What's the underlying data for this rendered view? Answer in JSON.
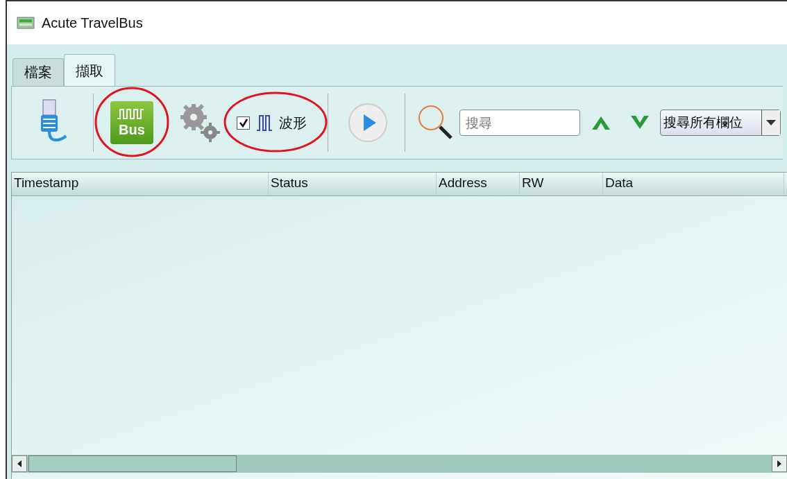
{
  "window": {
    "title": "Acute TravelBus"
  },
  "tabs": [
    {
      "label": "檔案",
      "selected": false
    },
    {
      "label": "擷取",
      "selected": true
    }
  ],
  "toolbar": {
    "bus_button": {
      "label": "Bus"
    },
    "waveform": {
      "label": "波形",
      "checked": true
    },
    "search": {
      "placeholder": "搜尋"
    },
    "search_scope": {
      "value": "搜尋所有欄位"
    }
  },
  "table": {
    "columns": [
      "Timestamp",
      "Status",
      "Address",
      "RW",
      "Data"
    ]
  }
}
